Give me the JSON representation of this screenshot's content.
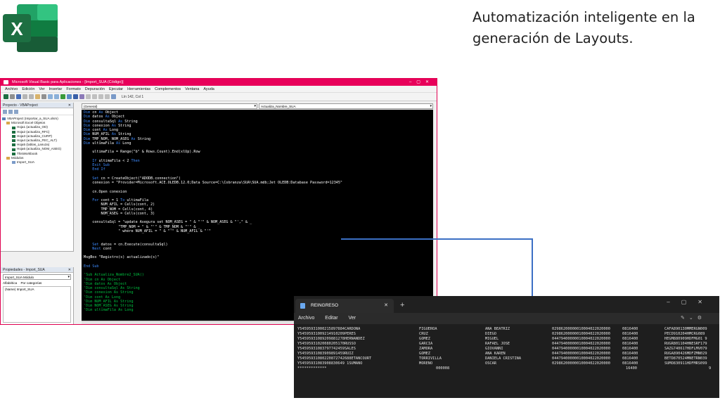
{
  "headline": {
    "line1": "Automatización inteligente en la",
    "line2": "generación de Layouts."
  },
  "colors": {
    "vba_title_bar": "#e8005a",
    "code_keyword": "#3d8bff",
    "code_comment": "#00c040",
    "connector": "#3b6fc4",
    "excel_green": "#1d6f42"
  },
  "excel_logo": {
    "icon": "excel-icon",
    "letter": "X"
  },
  "vba": {
    "title": "Microsoft Visual Basic para Aplicaciones - [Import_SUA (Código)]",
    "menu": [
      "Archivo",
      "Edición",
      "Ver",
      "Insertar",
      "Formato",
      "Depuración",
      "Ejecutar",
      "Herramientas",
      "Complementos",
      "Ventana",
      "Ayuda"
    ],
    "cursor_position": "Lín 142, Col 1",
    "project_title": "Proyecto - VBAProject",
    "tree": [
      "VBAProject (Importar_a_SUA.xlsm)",
      "Microsoft Excel Objetos",
      "Hoja1 (actualiza_OD)",
      "Hoja2 (actualiza_RFC)",
      "Hoja3 (actualiza_CURP)",
      "Hoja4 (actualiza_FEC_ALT)",
      "Hoja5 (tablas_Lanuza)",
      "Hoja6 (actualiza_NOM_ASEG)",
      "ThisWorkbook",
      "Módulos",
      "Import_SUA"
    ],
    "properties_title": "Propiedades - Import_SUA",
    "properties_object": "Import_SUA Módulo",
    "properties_tabs": [
      "Alfabética",
      "Por categorías"
    ],
    "properties_row": "(Name) Import_SUA",
    "combo_left": "(General)",
    "combo_right": "Actualiza_Nombre_SUA",
    "code": [
      [
        [
          "kw",
          "Dim "
        ],
        [
          "tx",
          "cn "
        ],
        [
          "kw",
          "As "
        ],
        [
          "tx",
          "Object"
        ]
      ],
      [
        [
          "kw",
          "Dim "
        ],
        [
          "tx",
          "datos "
        ],
        [
          "kw",
          "As "
        ],
        [
          "tx",
          "Object"
        ]
      ],
      [
        [
          "kw",
          "Dim "
        ],
        [
          "tx",
          "consultaSql "
        ],
        [
          "kw",
          "As "
        ],
        [
          "tx",
          "String"
        ]
      ],
      [
        [
          "kw",
          "Dim "
        ],
        [
          "tx",
          "conexion "
        ],
        [
          "kw",
          "As "
        ],
        [
          "tx",
          "String"
        ]
      ],
      [
        [
          "kw",
          "Dim "
        ],
        [
          "tx",
          "cont "
        ],
        [
          "kw",
          "As "
        ],
        [
          "tx",
          "Long"
        ]
      ],
      [
        [
          "kw",
          "Dim "
        ],
        [
          "tx",
          "NUM_AFIL "
        ],
        [
          "kw",
          "As "
        ],
        [
          "tx",
          "String"
        ]
      ],
      [
        [
          "kw",
          "Dim "
        ],
        [
          "tx",
          "TMP_NOM, NOM_ASEG "
        ],
        [
          "kw",
          "As "
        ],
        [
          "tx",
          "String"
        ]
      ],
      [
        [
          "kw",
          "Dim "
        ],
        [
          "tx",
          "ultimaFila "
        ],
        [
          "kw",
          "As "
        ],
        [
          "tx",
          "Long"
        ]
      ],
      [
        [
          "tx",
          ""
        ]
      ],
      [
        [
          "tx",
          "    ultimaFila = Range(\"b\" & Rows.Count).End(xlUp).Row"
        ]
      ],
      [
        [
          "tx",
          ""
        ]
      ],
      [
        [
          "kw",
          "    If "
        ],
        [
          "tx",
          "ultimaFila < 2 "
        ],
        [
          "kw",
          "Then"
        ]
      ],
      [
        [
          "kw",
          "    Exit Sub"
        ]
      ],
      [
        [
          "kw",
          "    End If"
        ]
      ],
      [
        [
          "tx",
          ""
        ]
      ],
      [
        [
          "kw",
          "    Set "
        ],
        [
          "tx",
          "cn = CreateObject(\"ADODB.connection\")"
        ]
      ],
      [
        [
          "tx",
          "    conexion = \"Provider=Microsoft.ACE.OLEDB.12.0;Data Source=C:\\Cobranza\\SUA\\SUA.mdb;Jet OLEDB:Database Password=12345\""
        ]
      ],
      [
        [
          "tx",
          ""
        ]
      ],
      [
        [
          "tx",
          "    cn.Open conexion"
        ]
      ],
      [
        [
          "tx",
          ""
        ]
      ],
      [
        [
          "kw",
          "    For "
        ],
        [
          "tx",
          "cont = 1 "
        ],
        [
          "kw",
          "To "
        ],
        [
          "tx",
          "ultimaFila"
        ]
      ],
      [
        [
          "tx",
          "        NUM_AFIL = Cells(cont, 2)"
        ]
      ],
      [
        [
          "tx",
          "        TMP_NOM = Cells(cont, 4)"
        ]
      ],
      [
        [
          "tx",
          "        NOM_ASEG = Cells(cont, 3)"
        ]
      ],
      [
        [
          "tx",
          ""
        ]
      ],
      [
        [
          "tx",
          "    consultaSql = \"update Asegura set NOM_ASEG = \" & \"'\" & NOM_ASEG & \"',\" & _"
        ]
      ],
      [
        [
          "tx",
          "                \"TMP_NOM = \" & \"'\" & TMP_NOM & \"'\" & _"
        ]
      ],
      [
        [
          "tx",
          "                \" where NUM_AFIL = \" & \"'\" & NUM_AFIL & \"'\""
        ]
      ],
      [
        [
          "tx",
          ""
        ]
      ],
      [
        [
          "tx",
          ""
        ]
      ],
      [
        [
          "kw",
          "    Set "
        ],
        [
          "tx",
          "datos = cn.Execute(consultaSql)"
        ]
      ],
      [
        [
          "kw",
          "    Next "
        ],
        [
          "tx",
          "cont"
        ]
      ],
      [
        [
          "tx",
          ""
        ]
      ],
      [
        [
          "tx",
          "MsgBox \"Registro(s) actualizado(s)\""
        ]
      ],
      [
        [
          "tx",
          ""
        ]
      ],
      [
        [
          "kw",
          "End Sub"
        ]
      ],
      [
        [
          "tx",
          ""
        ]
      ],
      [
        [
          "cm",
          "'Sub Actualiza_Nombre2_SUA()"
        ]
      ],
      [
        [
          "cm",
          "'Dim cn As Object"
        ]
      ],
      [
        [
          "cm",
          "'Dim datos As Object"
        ]
      ],
      [
        [
          "cm",
          "'Dim consultaSql As String"
        ]
      ],
      [
        [
          "cm",
          "'Dim conexion As String"
        ]
      ],
      [
        [
          "cm",
          "'Dim cont As Long"
        ]
      ],
      [
        [
          "cm",
          "'Dim NUM_AFIL As String"
        ]
      ],
      [
        [
          "cm",
          "'Dim NOM_ASEG As String"
        ]
      ],
      [
        [
          "cm",
          "'Dim ultimaFila As Long"
        ]
      ]
    ]
  },
  "terminal": {
    "tab_title": "REINGRESO",
    "tab_add": "+",
    "menu": [
      "Archivo",
      "Editar",
      "Ver"
    ],
    "rows": [
      [
        "Y54595931000215897884CARDONA",
        "FIGUEROA",
        "ANA BEATRIZ",
        "02986200000010004022020000",
        "0816400",
        "CAFA890130MMERGN009"
      ],
      [
        "Y54595931009214910209PERES",
        "CRUZ",
        "DIEGO",
        "02986200000010004022020000",
        "0816400",
        "PECD910204HMCRG089"
      ],
      [
        "Y54595931089209881278HERNANDEZ",
        "GOMEZ",
        "MIGUEL",
        "04479400000010004022020000",
        "0816400",
        "HEGM880909HDFMG01 9"
      ],
      [
        "Y54595931020080205170RUSSO",
        "GARCIA",
        "RAFAEL JOSE",
        "04479400000010004022020000",
        "0816400",
        "RUGR801104HNESRF179"
      ],
      [
        "Y54595931083797742459SALES",
        "ZAMORA",
        "GIOVANNI",
        "04479400000010004022020000",
        "0816400",
        "SAZG740617HDFLMV079"
      ],
      [
        "Y54595931083909891459RUIZ",
        "GOMEZ",
        "ANA KAREN",
        "04479400000010004022020000",
        "0816400",
        "RUGA890426MDFZMN029"
      ],
      [
        "Y54595931080220872742688ETANCOURT",
        "TORRIVILLA",
        "DANIELA CRISTINA",
        "04479400000010004022020000",
        "0816400",
        "BETD870524MNETRN039"
      ],
      [
        "Y54595931083908830649 1SUMANO",
        "MORENO",
        "OSCAR",
        "02986200000010004022020000",
        "0816400",
        "SUMO830911HDFMRS099"
      ],
      [
        "*************",
        "000008",
        "",
        "",
        "16400",
        "9"
      ]
    ]
  }
}
